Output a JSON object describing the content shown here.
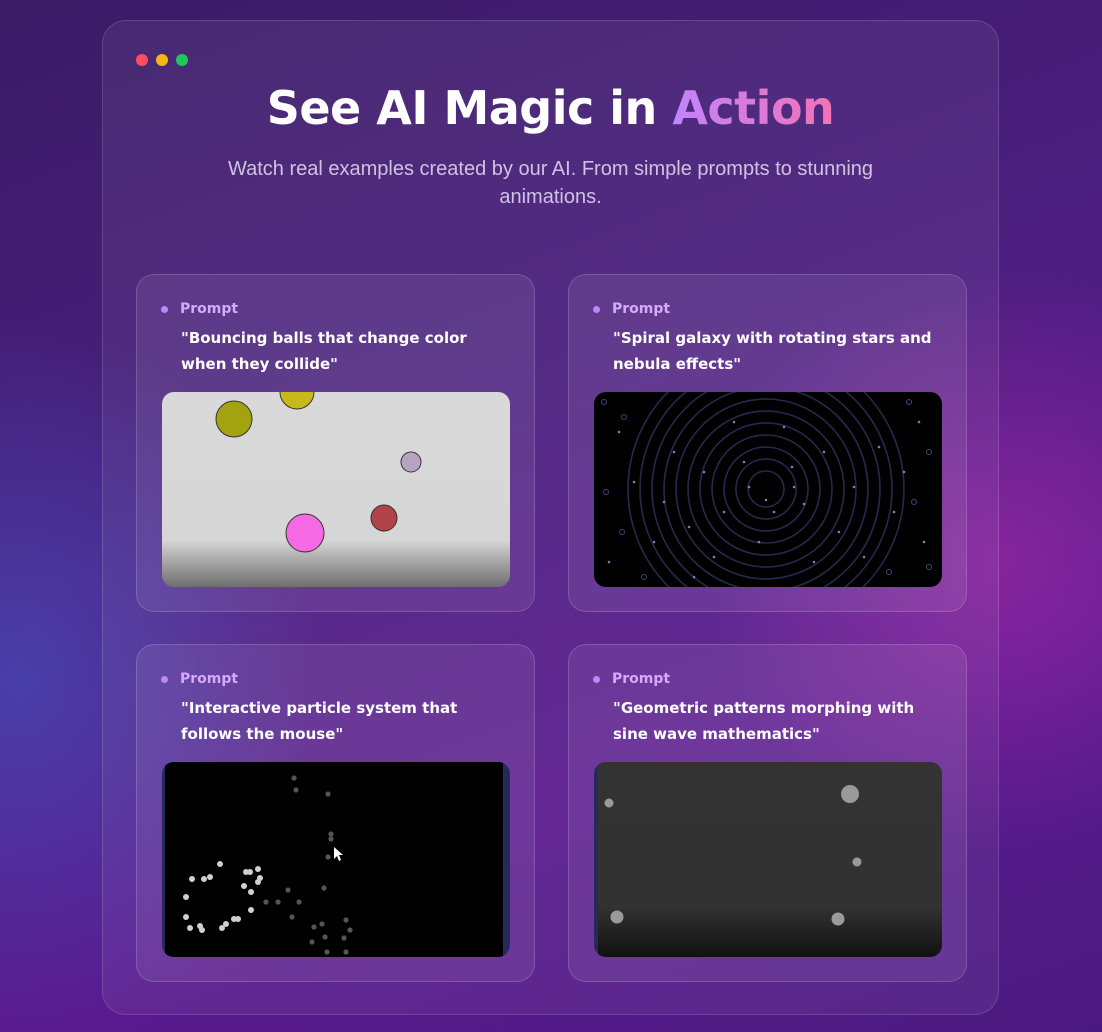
{
  "window": {
    "controls": [
      {
        "name": "close",
        "color": "#ff4d5e"
      },
      {
        "name": "minimize",
        "color": "#f5b614"
      },
      {
        "name": "maximize",
        "color": "#1ec85a"
      }
    ]
  },
  "header": {
    "title_main": "See AI Magic in ",
    "title_accent": "Action",
    "subtitle": "Watch real examples created by our AI. From simple prompts to stunning animations."
  },
  "colors": {
    "accent_start": "#c084fc",
    "accent_end": "#f472b6",
    "prompt_label": "#d6a9ff"
  },
  "examples": [
    {
      "label": "Prompt",
      "prompt": "\"Bouncing balls that change color when they collide\"",
      "preview": "bouncing-balls-canvas"
    },
    {
      "label": "Prompt",
      "prompt": "\"Spiral galaxy with rotating stars and nebula effects\"",
      "preview": "spiral-galaxy-canvas"
    },
    {
      "label": "Prompt",
      "prompt": "\"Interactive particle system that follows the mouse\"",
      "preview": "particle-system-canvas"
    },
    {
      "label": "Prompt",
      "prompt": "\"Geometric patterns morphing with sine wave mathematics\"",
      "preview": "geometric-patterns-canvas"
    }
  ]
}
